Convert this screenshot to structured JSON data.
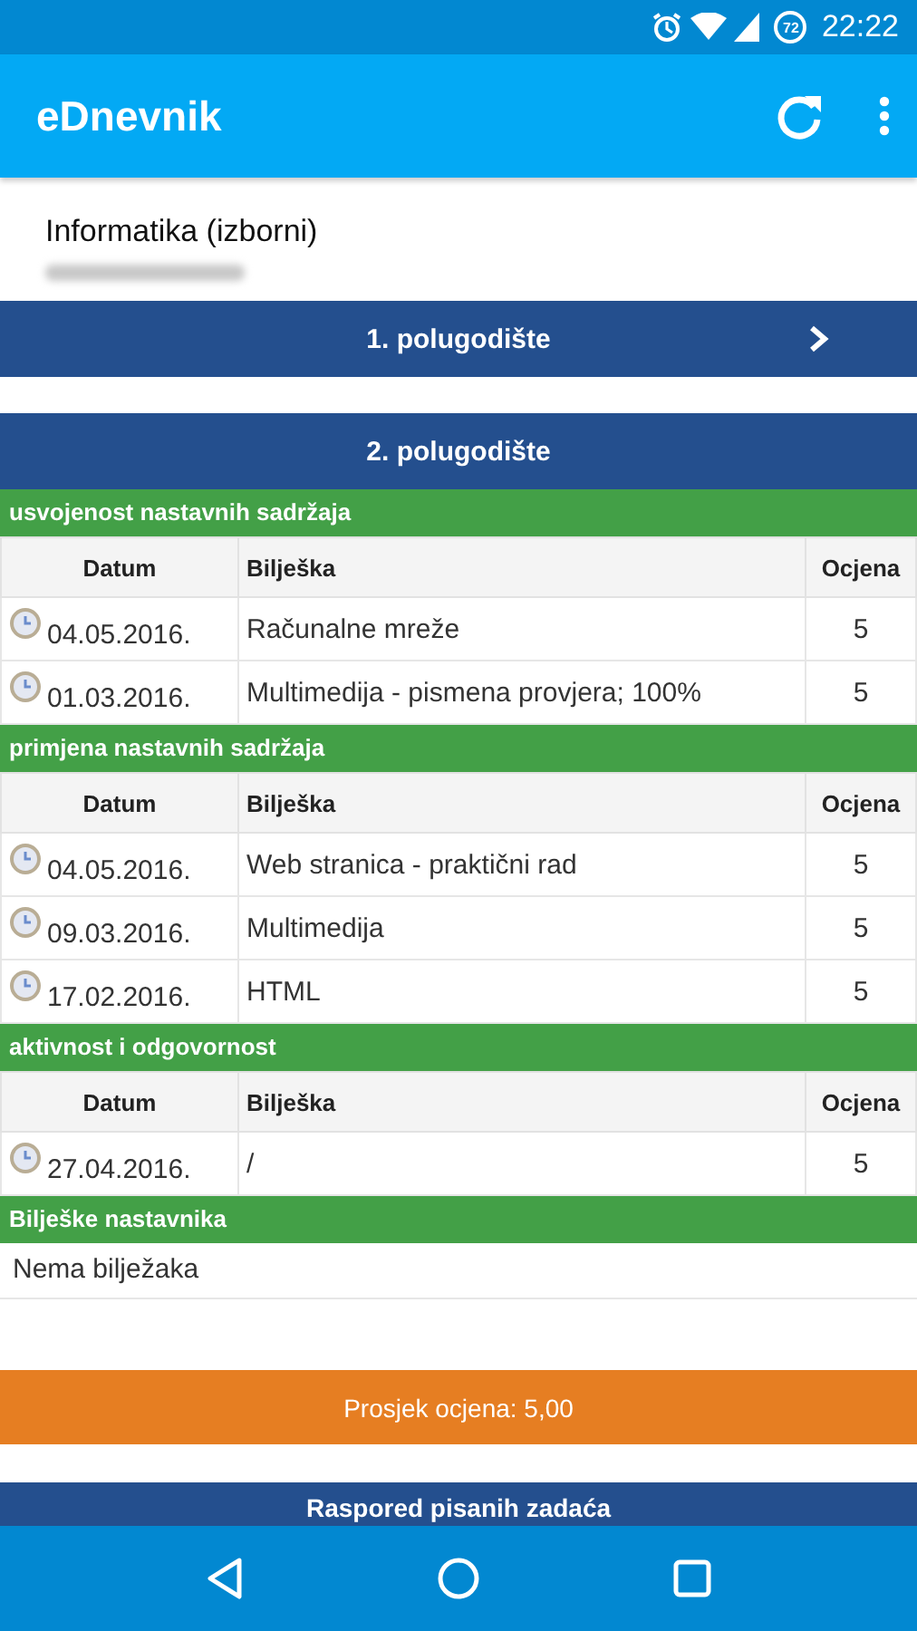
{
  "status_bar": {
    "time": "22:22",
    "battery": "72"
  },
  "app_bar": {
    "title": "eDnevnik"
  },
  "subject": {
    "title": "Informatika (izborni)",
    "teacher_redacted": true
  },
  "terms": [
    {
      "label": "1. polugodište",
      "expanded": false
    },
    {
      "label": "2. polugodište",
      "expanded": true
    }
  ],
  "sections": [
    {
      "kind": "grades",
      "title": "usvojenost nastavnih sadržaja",
      "columns": [
        "Datum",
        "Bilješka",
        "Ocjena"
      ],
      "rows": [
        {
          "date": "04.05.2016.",
          "note": "Računalne mreže",
          "grade": "5"
        },
        {
          "date": "01.03.2016.",
          "note": "Multimedija - pismena provjera; 100%",
          "grade": "5"
        }
      ]
    },
    {
      "kind": "grades",
      "title": "primjena nastavnih sadržaja",
      "columns": [
        "Datum",
        "Bilješka",
        "Ocjena"
      ],
      "rows": [
        {
          "date": "04.05.2016.",
          "note": "Web stranica - praktični rad",
          "grade": "5"
        },
        {
          "date": "09.03.2016.",
          "note": "Multimedija",
          "grade": "5"
        },
        {
          "date": "17.02.2016.",
          "note": "HTML",
          "grade": "5"
        }
      ]
    },
    {
      "kind": "grades",
      "title": "aktivnost i odgovornost",
      "columns": [
        "Datum",
        "Bilješka",
        "Ocjena"
      ],
      "rows": [
        {
          "date": "27.04.2016.",
          "note": "/",
          "grade": "5"
        }
      ]
    },
    {
      "kind": "notes",
      "title": "Bilješke nastavnika",
      "text": "Nema bilježaka"
    }
  ],
  "average": "Prosjek ocjena: 5,00",
  "next_section": "Raspored pisanih zadaća"
}
